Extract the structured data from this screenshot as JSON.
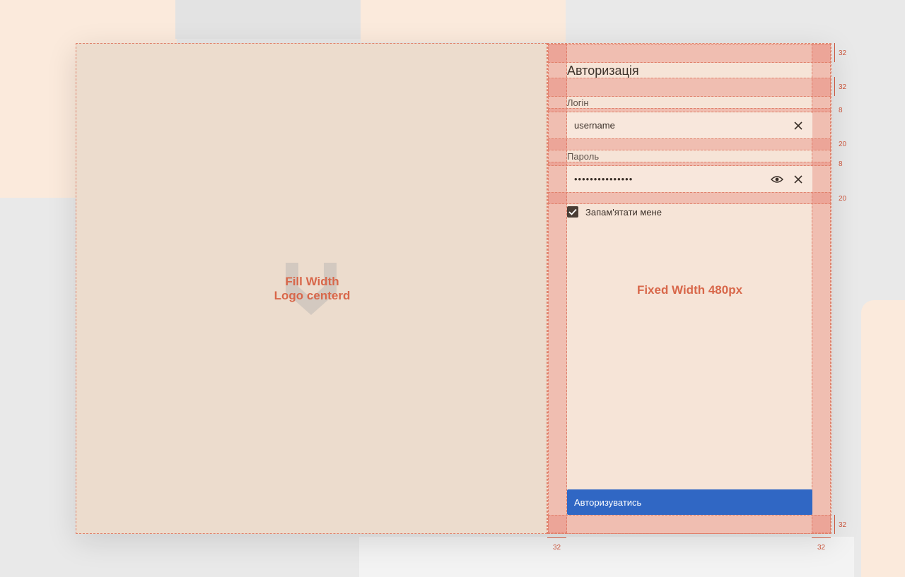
{
  "left_panel": {
    "note_line1": "Fill Width",
    "note_line2": "Logo centerd",
    "logo_icon": "logo-chevron-icon"
  },
  "form": {
    "title": "Авторизація",
    "login_label": "Логін",
    "login_value": "username",
    "password_label": "Пароль",
    "password_value": "•••••••••••••••",
    "remember_label": "Запам'ятати мене",
    "remember_checked": true,
    "submit_label": "Авторизуватись",
    "width_note": "Fixed Width 480px"
  },
  "dimensions": {
    "pad_top": "32",
    "title_gap": "32",
    "label_gap_1": "8",
    "field_gap_1": "20",
    "label_gap_2": "8",
    "field_gap_2": "20",
    "pad_bottom": "32",
    "pad_left": "32",
    "pad_right": "32"
  },
  "colors": {
    "left_bg": "#ecdccd",
    "right_bg": "#f6e4d7",
    "annotation": "#d8674a",
    "primary_button": "#3067c4"
  }
}
